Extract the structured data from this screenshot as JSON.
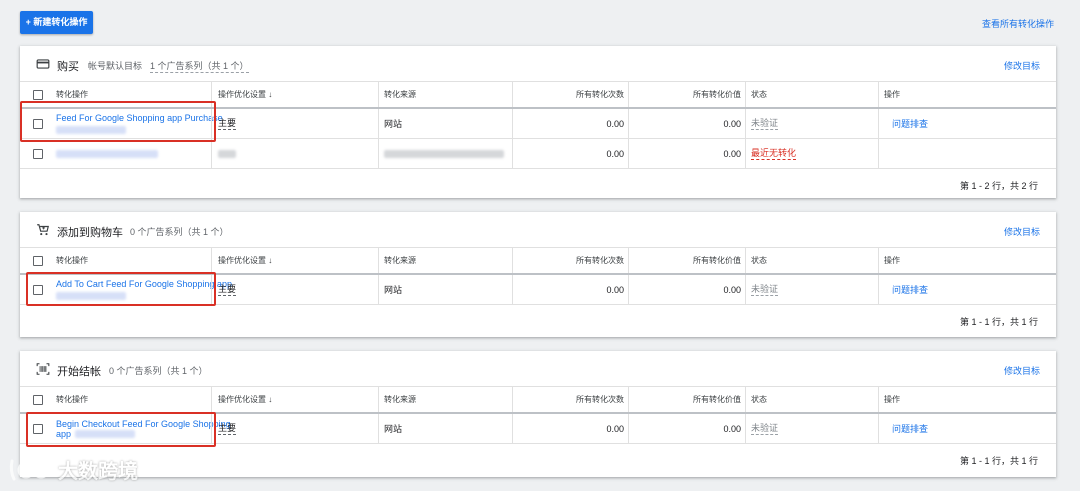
{
  "toolbar": {
    "new_label": "+ 新建转化操作",
    "view_all_label": "查看所有转化操作"
  },
  "columns": {
    "name": "转化操作",
    "optimization": "操作优化设置 ↓",
    "source": "转化来源",
    "all_conv": "所有转化次数",
    "all_value": "所有转化价值",
    "status": "状态",
    "actions": "操作"
  },
  "sections": [
    {
      "title": "购买",
      "sub1": "帐号默认目标",
      "sub2": "1 个广告系列（共 1 个）",
      "edit_label": "修改目标",
      "icon": "credit-card-icon",
      "rows": [
        {
          "name": "Feed For Google Shopping app Purchase",
          "optimization": "主要",
          "source": "网站",
          "all_conv": "0.00",
          "all_value": "0.00",
          "status": "未验证",
          "action": "问题排查"
        },
        {
          "name": "",
          "optimization": "",
          "source": "",
          "all_conv": "0.00",
          "all_value": "0.00",
          "status": "最近无转化",
          "action": ""
        }
      ],
      "footer": "第 1 - 2 行，共 2 行"
    },
    {
      "title": "添加到购物车",
      "sub1": "0 个广告系列（共 1 个）",
      "edit_label": "修改目标",
      "icon": "cart-icon",
      "rows": [
        {
          "name": "Add To Cart Feed For Google Shopping app",
          "optimization": "主要",
          "source": "网站",
          "all_conv": "0.00",
          "all_value": "0.00",
          "status": "未验证",
          "action": "问题排查"
        }
      ],
      "footer": "第 1 - 1 行，共 1 行"
    },
    {
      "title": "开始结帐",
      "sub1": "0 个广告系列（共 1 个）",
      "edit_label": "修改目标",
      "icon": "barcode-icon",
      "rows": [
        {
          "name_line1": "Begin Checkout Feed For Google Shopping",
          "name_line2": "app",
          "optimization": "主要",
          "source": "网站",
          "all_conv": "0.00",
          "all_value": "0.00",
          "status": "未验证",
          "action": "问题排查"
        }
      ],
      "footer": "第 1 - 1 行，共 1 行"
    }
  ],
  "watermark": {
    "text": "大数跨境"
  },
  "colors": {
    "accent": "#1a73e8",
    "error": "#d93025",
    "highlight_box": "#d93025"
  }
}
